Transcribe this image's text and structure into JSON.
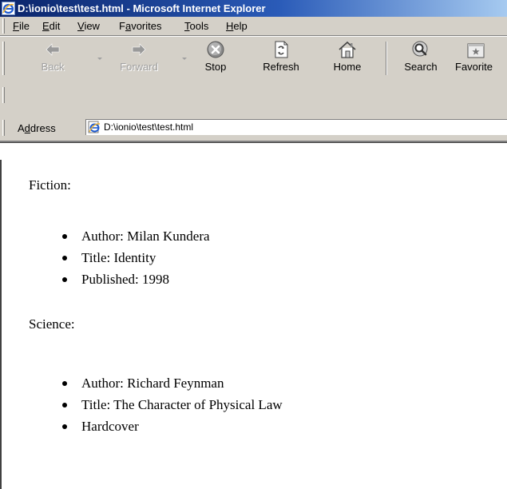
{
  "window": {
    "title": "D:\\ionio\\test\\test.html - Microsoft Internet Explorer"
  },
  "menu": {
    "items": [
      {
        "first": "F",
        "rest": "ile"
      },
      {
        "first": "E",
        "rest": "dit"
      },
      {
        "first": "V",
        "rest": "iew"
      },
      {
        "pre": "F",
        "first": "a",
        "rest": "vorites"
      },
      {
        "first": "T",
        "rest": "ools"
      },
      {
        "first": "H",
        "rest": "elp"
      }
    ]
  },
  "toolbar": {
    "back_label": "Back",
    "forward_label": "Forward",
    "stop_label": "Stop",
    "refresh_label": "Refresh",
    "home_label": "Home",
    "search_label": "Search",
    "favorites_label": "Favorite"
  },
  "address": {
    "label_pre": "A",
    "label_accel": "d",
    "label_rest": "dress",
    "value": "D:\\ionio\\test\\test.html"
  },
  "content": {
    "fiction": {
      "heading": "Fiction:",
      "items": [
        "Author: Milan Kundera",
        "Title: Identity",
        "Published: 1998"
      ]
    },
    "science": {
      "heading": "Science:",
      "items": [
        "Author: Richard Feynman",
        "Title: The Character of Physical Law",
        "Hardcover"
      ]
    }
  }
}
